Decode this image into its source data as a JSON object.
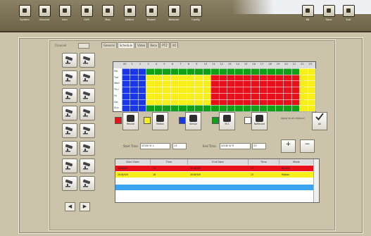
{
  "toolbar": {
    "left": [
      {
        "label": "System",
        "icon": "monitor-icon"
      },
      {
        "label": "Channel",
        "icon": "channel-icon"
      },
      {
        "label": "User",
        "icon": "user-icon"
      },
      {
        "label": "OVR",
        "icon": "dvr-icon"
      },
      {
        "label": "Map",
        "icon": "map-icon"
      },
      {
        "label": "Detect",
        "icon": "detect-icon"
      },
      {
        "label": "Report",
        "icon": "report-icon"
      },
      {
        "label": "Network",
        "icon": "network-icon"
      },
      {
        "label": "Config",
        "icon": "tools-icon"
      }
    ],
    "right": [
      {
        "label": "KB",
        "icon": "keyboard-icon"
      },
      {
        "label": "Save",
        "icon": "save-icon"
      },
      {
        "label": "Exit",
        "icon": "power-icon"
      }
    ]
  },
  "channel": {
    "label": "Channel",
    "value": ""
  },
  "tabs": [
    "General",
    "Schedule",
    "Video",
    "Rece",
    "PTZ",
    "I/O"
  ],
  "cameras": {
    "count": 16
  },
  "schedule": {
    "hours": [
      "00",
      "1",
      "2",
      "3",
      "4",
      "5",
      "6",
      "7",
      "8",
      "9",
      "10",
      "11",
      "12",
      "13",
      "14",
      "15",
      "16",
      "17",
      "18",
      "19",
      "20",
      "21",
      "22",
      "23"
    ],
    "days": [
      "Mo",
      "Tue",
      "Wed",
      "Thu",
      "Fri",
      "Sat",
      "Sun"
    ],
    "colors": {
      "record": "#e8101a",
      "motion": "#f8ee1a",
      "sensor": "#1838e8",
      "m_s": "#12a018",
      "none": "#ffffff"
    }
  },
  "legend": [
    {
      "color": "#e8101a",
      "label": "Record",
      "icon": "record-icon"
    },
    {
      "color": "#f8ee1a",
      "label": "Motion",
      "icon": "motion-icon"
    },
    {
      "color": "#1838e8",
      "label": "Sensor",
      "icon": "sensor-icon"
    },
    {
      "color": "#12a018",
      "label": "M-S",
      "icon": "motion-sensor-icon"
    },
    {
      "color": "#ffffff",
      "label": "NoRecord",
      "icon": "no-record-icon"
    }
  ],
  "apply_label": "Apply to all channel",
  "all_label": "All",
  "time": {
    "start_label": "Start Time",
    "start_date": "2016/ 9/ 1",
    "start_hour": "13",
    "end_label": "End Time",
    "end_date": "2016/ 9/ 9",
    "end_hour": "23"
  },
  "table": {
    "columns": [
      "Start Date",
      "Time",
      "End Date",
      "Time",
      "Mode"
    ],
    "rows": [
      {
        "start_date": "2016/9/1",
        "start_time": "13",
        "end_date": "2016/9/9",
        "end_time": "23",
        "mode": "Record",
        "color": "#e8101a"
      },
      {
        "start_date": "2016/9/9",
        "start_time": "16",
        "end_date": "2016/9/9",
        "end_time": "23",
        "mode": "Motion",
        "color": "#f8ee1a"
      },
      {
        "start_date": "",
        "start_time": "",
        "end_date": "",
        "end_time": "",
        "mode": "",
        "color": "#ffffff"
      },
      {
        "start_date": "",
        "start_time": "",
        "end_date": "",
        "end_time": "",
        "mode": "",
        "color": "#3aa4f0"
      },
      {
        "start_date": "",
        "start_time": "",
        "end_date": "",
        "end_time": "",
        "mode": "",
        "color": "#ffffff"
      }
    ]
  }
}
